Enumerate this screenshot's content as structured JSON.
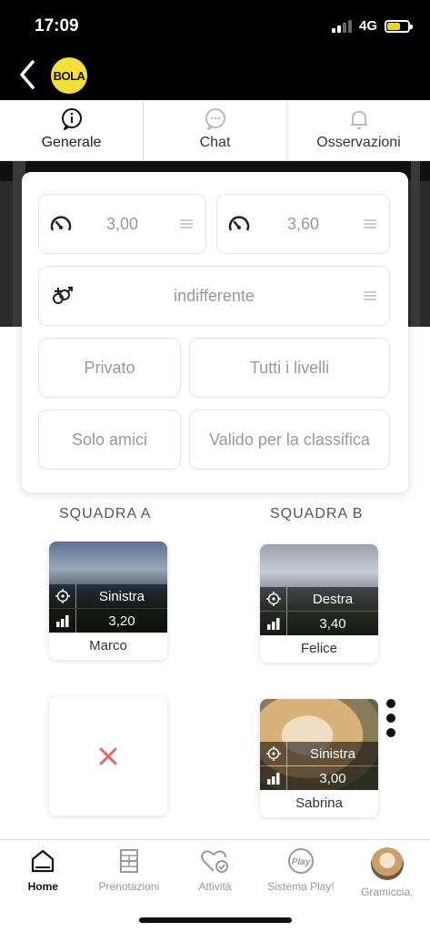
{
  "status_bar": {
    "time": "17:09",
    "network": "4G"
  },
  "header": {
    "logo_text": "BOLA"
  },
  "tabs": [
    {
      "label": "Generale",
      "icon": "info-icon",
      "active": true
    },
    {
      "label": "Chat",
      "icon": "chat-icon",
      "active": false
    },
    {
      "label": "Osservazioni",
      "icon": "bell-icon",
      "active": false
    }
  ],
  "filters": {
    "level_min": "3,00",
    "level_max": "3,60",
    "gender": "indifferente",
    "visibility": "Privato",
    "levels": "Tutti i livelli",
    "friends": "Solo amici",
    "ranking": "Valido per la classifica"
  },
  "teams": {
    "a": {
      "title": "SQUADRA A",
      "players": [
        {
          "name": "Marco",
          "side": "Sinistra",
          "level": "3,20"
        }
      ]
    },
    "b": {
      "title": "SQUADRA B",
      "players": [
        {
          "name": "Felice",
          "side": "Destra",
          "level": "3,40"
        },
        {
          "name": "Sabrina",
          "side": "Sinistra",
          "level": "3,00"
        }
      ]
    }
  },
  "bottom_nav": [
    {
      "label": "Home",
      "icon": "home-icon",
      "active": true
    },
    {
      "label": "Prenotazioni",
      "icon": "court-icon",
      "active": false
    },
    {
      "label": "Attività",
      "icon": "heart-check-icon",
      "active": false
    },
    {
      "label": "Sistema Play!",
      "icon": "play-badge-icon",
      "active": false
    },
    {
      "label": "Gramiccia,",
      "icon": "avatar",
      "active": false
    }
  ],
  "colors": {
    "accent_logo": "#f5df3d",
    "empty_slot_x": "#e8676b"
  }
}
